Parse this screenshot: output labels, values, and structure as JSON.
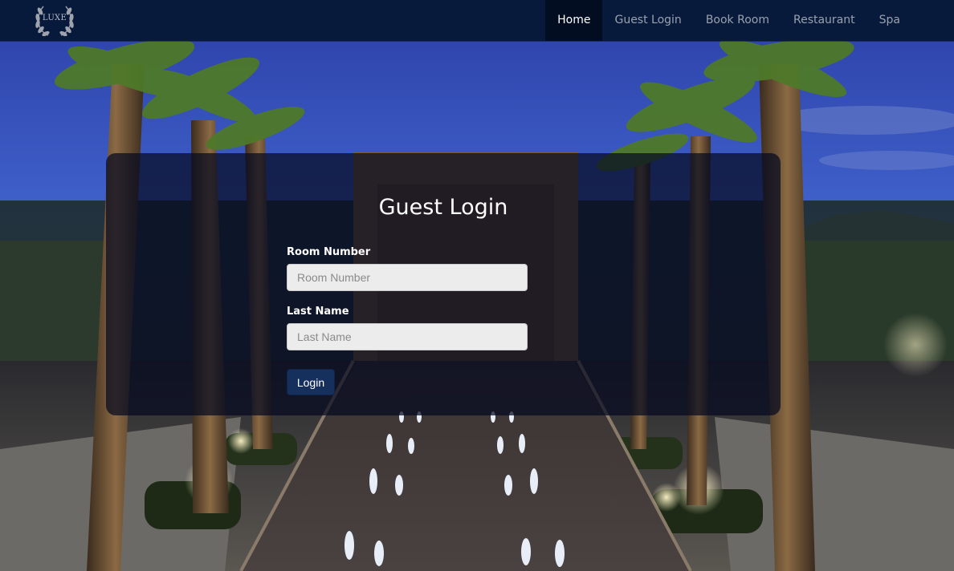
{
  "brand": {
    "logo_text": "LUXE"
  },
  "nav": {
    "items": [
      {
        "label": "Home",
        "active": true
      },
      {
        "label": "Guest Login"
      },
      {
        "label": "Book Room"
      },
      {
        "label": "Restaurant"
      },
      {
        "label": "Spa"
      }
    ]
  },
  "login": {
    "title": "Guest Login",
    "room_label": "Room Number",
    "room_placeholder": "Room Number",
    "room_value": "",
    "lastname_label": "Last Name",
    "lastname_placeholder": "Last Name",
    "lastname_value": "",
    "submit_label": "Login"
  },
  "colors": {
    "navbar": "#071a3c",
    "nav_active": "#020d22",
    "button": "#16305e",
    "panel": "rgba(6,10,32,0.72)"
  },
  "icons": {
    "logo": "laurel-wreath-icon"
  }
}
